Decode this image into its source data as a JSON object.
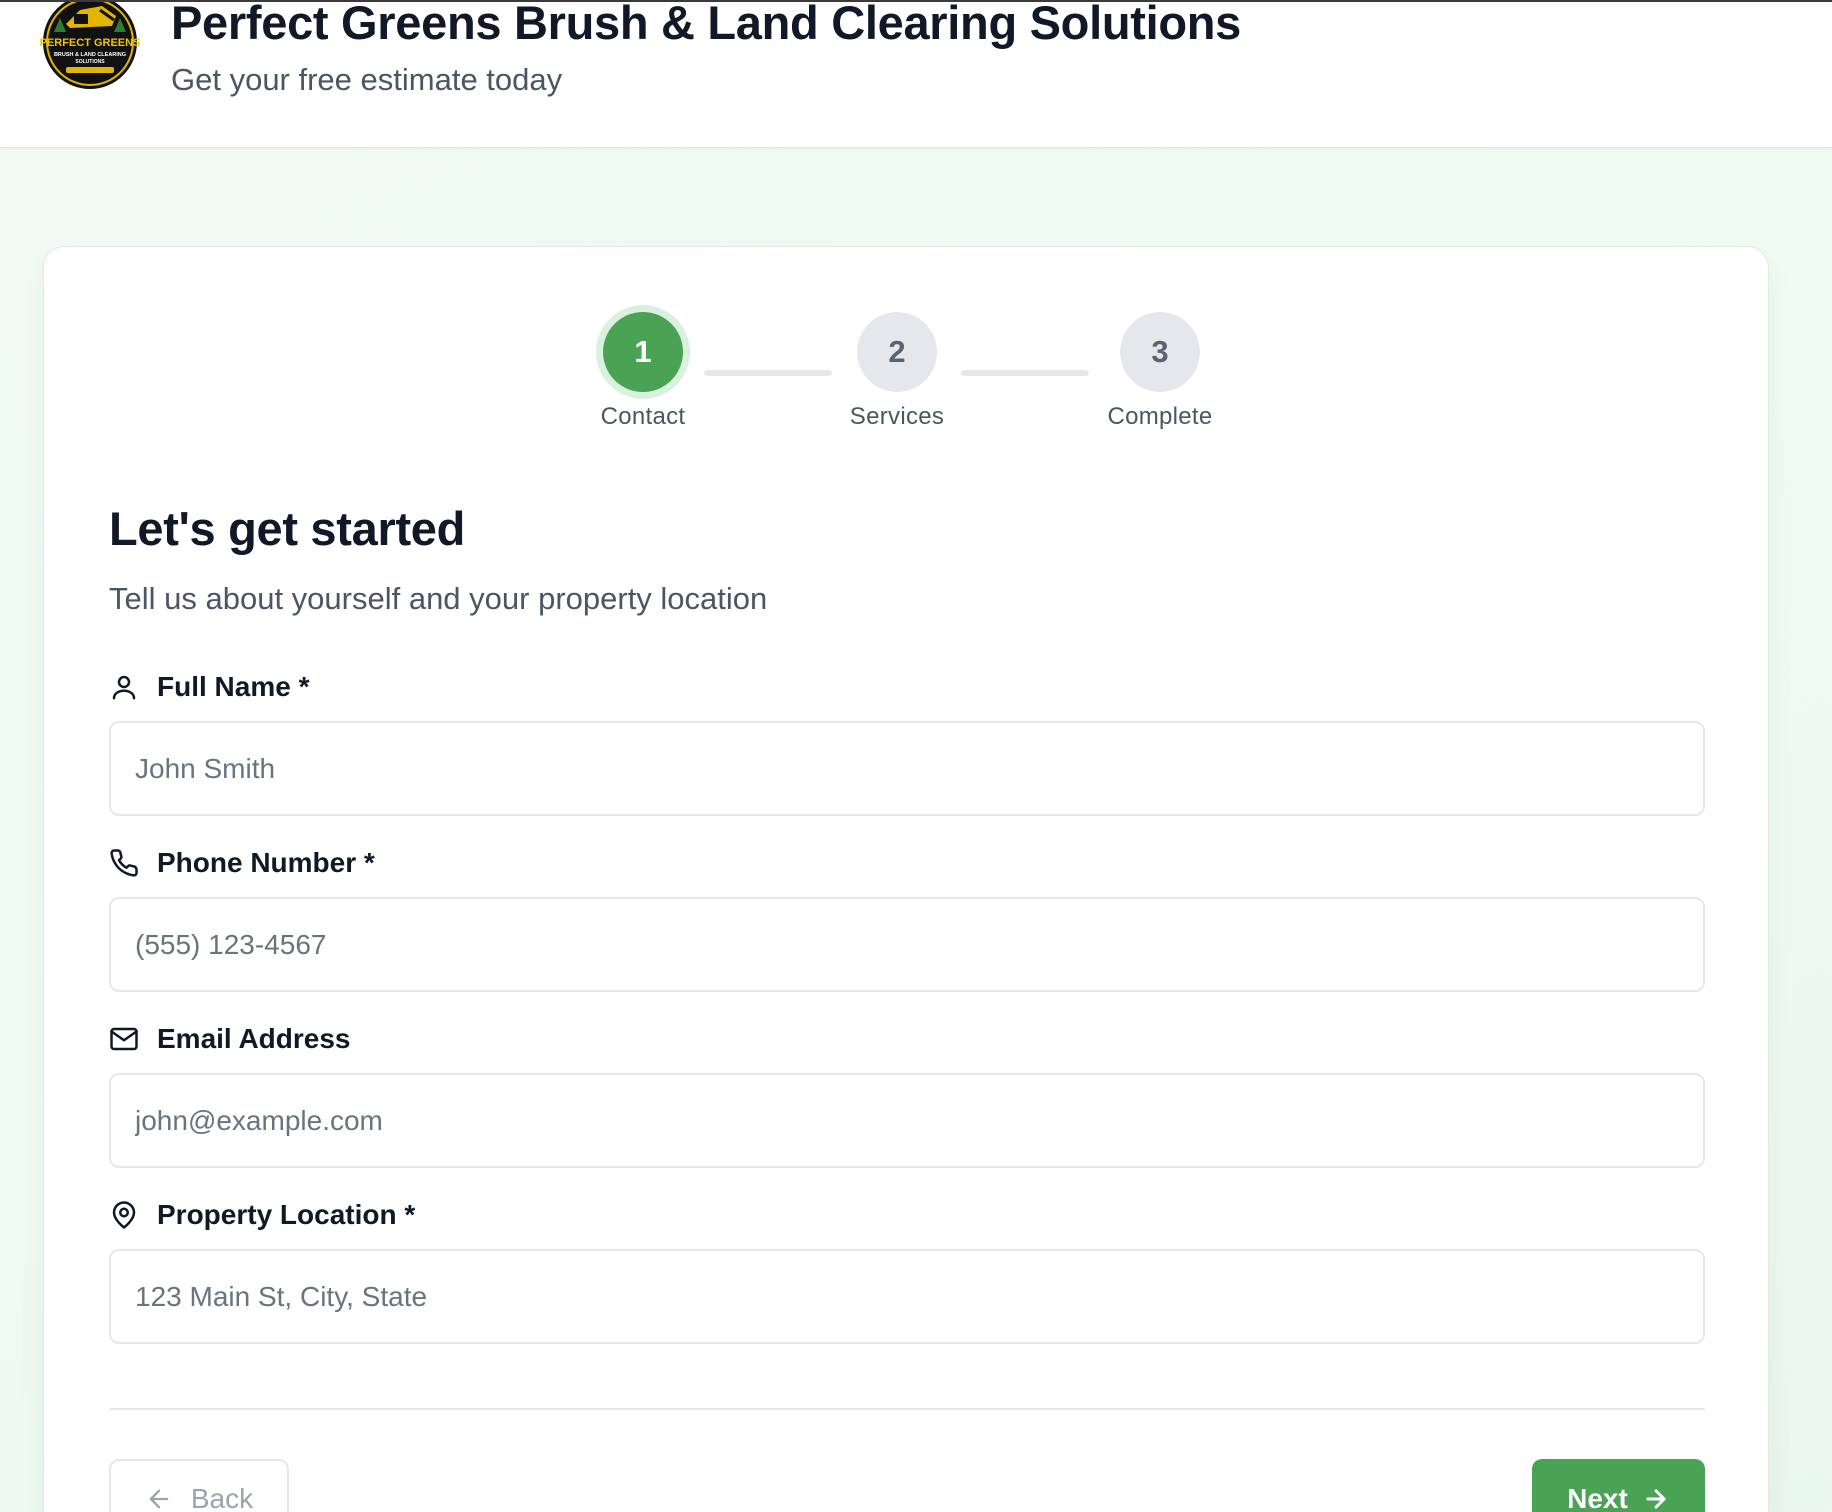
{
  "header": {
    "company_name": "Perfect Greens Brush & Land Clearing Solutions",
    "tagline": "Get your free estimate today",
    "logo": {
      "top_text": "PERFECT GREENS",
      "middle_text": "BRUSH & LAND CLEARING",
      "bottom_text": "SOLUTIONS"
    }
  },
  "stepper": {
    "steps": [
      {
        "number": "1",
        "label": "Contact",
        "state": "active"
      },
      {
        "number": "2",
        "label": "Services",
        "state": "pending"
      },
      {
        "number": "3",
        "label": "Complete",
        "state": "pending"
      }
    ],
    "current_step": 1,
    "total_steps": 3
  },
  "form": {
    "title": "Let's get started",
    "subtitle": "Tell us about yourself and your property location",
    "fields": [
      {
        "label": "Full Name *",
        "icon": "user-icon",
        "placeholder": "John Smith",
        "value": ""
      },
      {
        "label": "Phone Number *",
        "icon": "phone-icon",
        "placeholder": "(555) 123-4567",
        "value": ""
      },
      {
        "label": "Email Address",
        "icon": "mail-icon",
        "placeholder": "john@example.com",
        "value": ""
      },
      {
        "label": "Property Location *",
        "icon": "map-pin-icon",
        "placeholder": "123 Main St, City, State",
        "value": ""
      }
    ]
  },
  "actions": {
    "back_label": "Back",
    "next_label": "Next"
  },
  "colors": {
    "accent": "#4aa254",
    "accent_ring": "#d9f1de",
    "background": "#f0fbf3",
    "text_primary": "#111827",
    "text_secondary": "#4b5563"
  }
}
